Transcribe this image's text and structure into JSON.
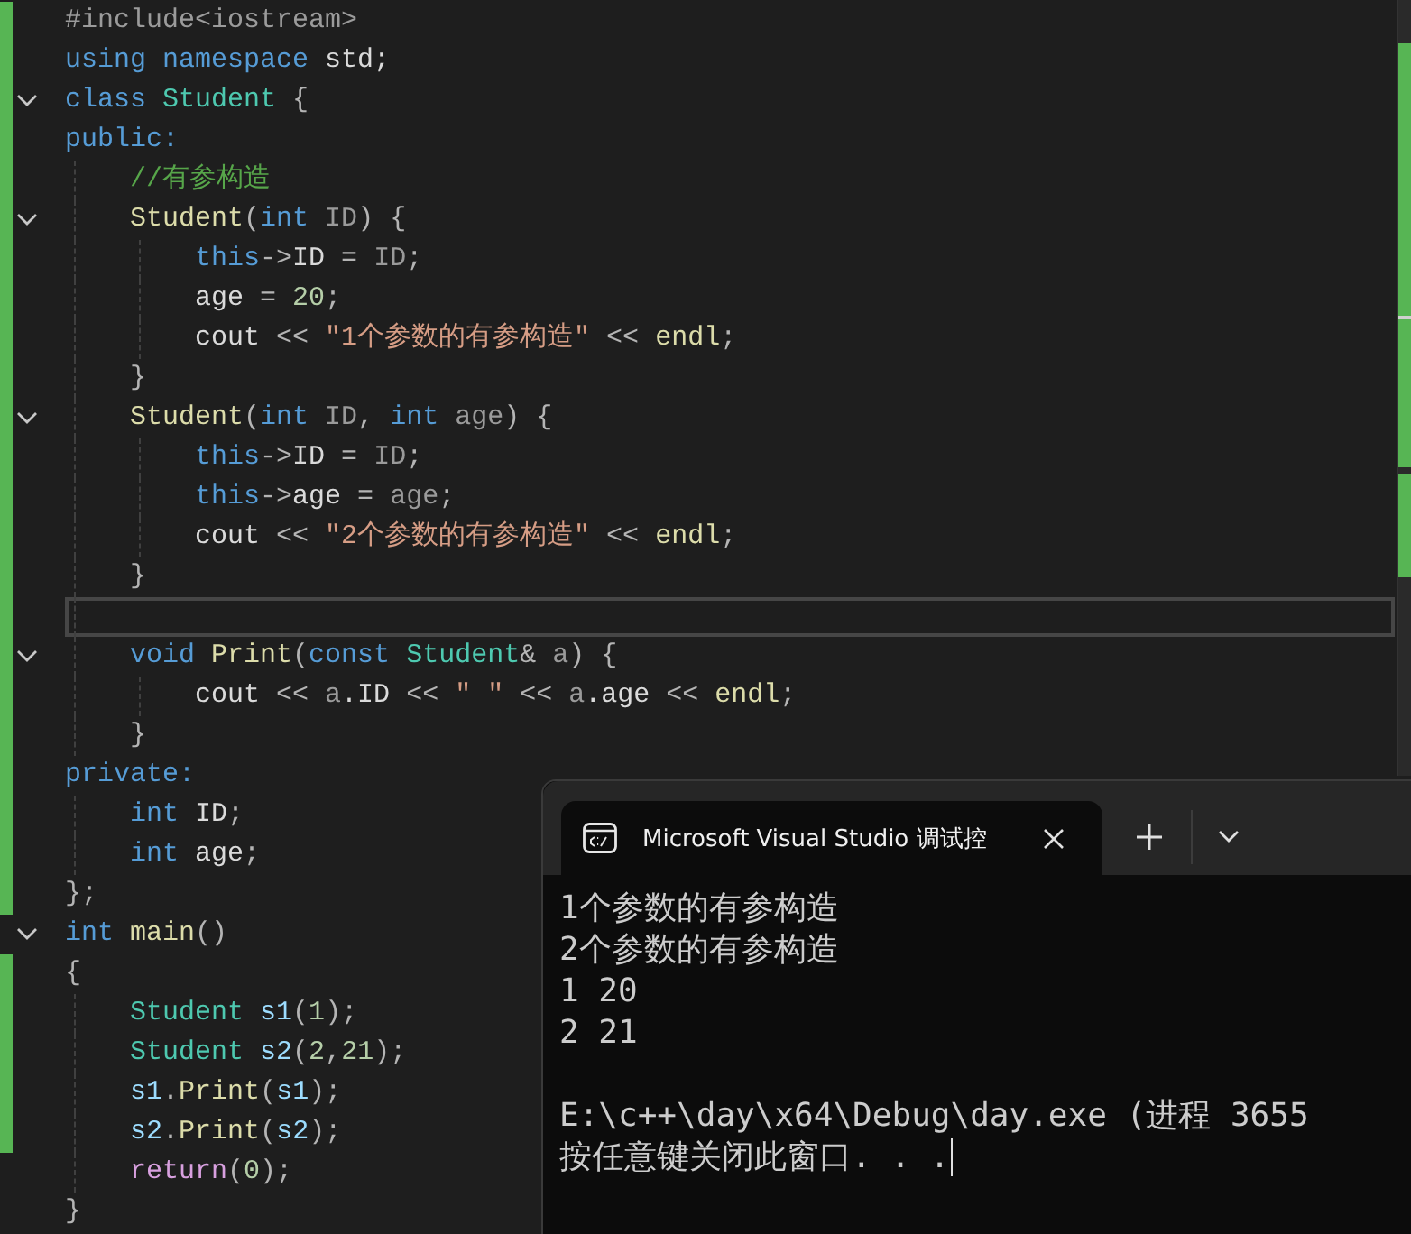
{
  "editor": {
    "lines": [
      {
        "tokens": [
          {
            "text": "#include<iostream>",
            "kind": "pp"
          }
        ],
        "changed": true,
        "current": false
      },
      {
        "tokens": [
          {
            "text": "using",
            "kind": "kw"
          },
          {
            "text": " namespace",
            "kind": "kw"
          },
          {
            "text": " std;",
            "kind": "field"
          }
        ],
        "changed": true,
        "current": false
      },
      {
        "tokens": [
          {
            "text": "class",
            "kind": "kw"
          },
          {
            "text": " Student",
            "kind": "type"
          },
          {
            "text": " {",
            "kind": "p"
          }
        ],
        "changed": true,
        "current": false,
        "collapsed": false
      },
      {
        "tokens": [
          {
            "text": "public:",
            "kind": "kw"
          }
        ],
        "changed": true,
        "current": false,
        "children": [
          {
            "tokens": [
              {
                "text": "//有参构造",
                "kind": "cmt"
              }
            ],
            "changed": true,
            "current": false
          },
          {
            "tokens": [
              {
                "text": "Student",
                "kind": "fn"
              },
              {
                "text": "(",
                "kind": "p"
              },
              {
                "text": "int",
                "kind": "kw"
              },
              {
                "text": " ID",
                "kind": "param"
              },
              {
                "text": ") {",
                "kind": "p"
              }
            ],
            "changed": true,
            "current": false,
            "collapsed": false,
            "children": [
              {
                "tokens": [
                  {
                    "text": "this",
                    "kind": "kw"
                  },
                  {
                    "text": "->",
                    "kind": "p"
                  },
                  {
                    "text": "ID",
                    "kind": "field"
                  },
                  {
                    "text": " = ",
                    "kind": "p"
                  },
                  {
                    "text": "ID",
                    "kind": "param"
                  },
                  {
                    "text": ";",
                    "kind": "p"
                  }
                ],
                "changed": true,
                "current": false
              },
              {
                "tokens": [
                  {
                    "text": "age",
                    "kind": "field"
                  },
                  {
                    "text": " = ",
                    "kind": "p"
                  },
                  {
                    "text": "20",
                    "kind": "num"
                  },
                  {
                    "text": ";",
                    "kind": "p"
                  }
                ],
                "changed": true,
                "current": false
              },
              {
                "tokens": [
                  {
                    "text": "cout",
                    "kind": "field"
                  },
                  {
                    "text": " << ",
                    "kind": "p"
                  },
                  {
                    "text": "\"1个参数的有参构造\"",
                    "kind": "str"
                  },
                  {
                    "text": " << ",
                    "kind": "p"
                  },
                  {
                    "text": "endl",
                    "kind": "fn"
                  },
                  {
                    "text": ";",
                    "kind": "p"
                  }
                ],
                "changed": true,
                "current": false
              }
            ]
          },
          {
            "tokens": [
              {
                "text": "}",
                "kind": "p"
              }
            ],
            "changed": true,
            "current": false
          },
          {
            "tokens": [
              {
                "text": "Student",
                "kind": "fn"
              },
              {
                "text": "(",
                "kind": "p"
              },
              {
                "text": "int",
                "kind": "kw"
              },
              {
                "text": " ID",
                "kind": "param"
              },
              {
                "text": ",",
                "kind": "p"
              },
              {
                "text": " int",
                "kind": "kw"
              },
              {
                "text": " age",
                "kind": "param"
              },
              {
                "text": ") {",
                "kind": "p"
              }
            ],
            "changed": true,
            "current": false,
            "collapsed": false,
            "children": [
              {
                "tokens": [
                  {
                    "text": "this",
                    "kind": "kw"
                  },
                  {
                    "text": "->",
                    "kind": "p"
                  },
                  {
                    "text": "ID",
                    "kind": "field"
                  },
                  {
                    "text": " = ",
                    "kind": "p"
                  },
                  {
                    "text": "ID",
                    "kind": "param"
                  },
                  {
                    "text": ";",
                    "kind": "p"
                  }
                ],
                "changed": true,
                "current": false
              },
              {
                "tokens": [
                  {
                    "text": "this",
                    "kind": "kw"
                  },
                  {
                    "text": "->",
                    "kind": "p"
                  },
                  {
                    "text": "age",
                    "kind": "field"
                  },
                  {
                    "text": " = ",
                    "kind": "p"
                  },
                  {
                    "text": "age",
                    "kind": "param"
                  },
                  {
                    "text": ";",
                    "kind": "p"
                  }
                ],
                "changed": true,
                "current": false
              },
              {
                "tokens": [
                  {
                    "text": "cout",
                    "kind": "field"
                  },
                  {
                    "text": " << ",
                    "kind": "p"
                  },
                  {
                    "text": "\"2个参数的有参构造\"",
                    "kind": "str"
                  },
                  {
                    "text": " << ",
                    "kind": "p"
                  },
                  {
                    "text": "endl",
                    "kind": "fn"
                  },
                  {
                    "text": ";",
                    "kind": "p"
                  }
                ],
                "changed": true,
                "current": false
              }
            ]
          },
          {
            "tokens": [
              {
                "text": "}",
                "kind": "p"
              }
            ],
            "changed": true,
            "current": false
          },
          {
            "changed": true,
            "current": true
          },
          {
            "tokens": [
              {
                "text": "void",
                "kind": "kw"
              },
              {
                "text": " Print",
                "kind": "fn"
              },
              {
                "text": "(",
                "kind": "p"
              },
              {
                "text": "const",
                "kind": "kw"
              },
              {
                "text": " Student",
                "kind": "type"
              },
              {
                "text": "&",
                "kind": "p"
              },
              {
                "text": " a",
                "kind": "param"
              },
              {
                "text": ") {",
                "kind": "p"
              }
            ],
            "changed": true,
            "current": false,
            "collapsed": false,
            "children": [
              {
                "tokens": [
                  {
                    "text": "cout",
                    "kind": "field"
                  },
                  {
                    "text": " << ",
                    "kind": "p"
                  },
                  {
                    "text": "a",
                    "kind": "param"
                  },
                  {
                    "text": ".ID",
                    "kind": "field"
                  },
                  {
                    "text": " << ",
                    "kind": "p"
                  },
                  {
                    "text": "\" \"",
                    "kind": "str"
                  },
                  {
                    "text": " << ",
                    "kind": "p"
                  },
                  {
                    "text": "a",
                    "kind": "param"
                  },
                  {
                    "text": ".age",
                    "kind": "field"
                  },
                  {
                    "text": " << ",
                    "kind": "p"
                  },
                  {
                    "text": "endl",
                    "kind": "fn"
                  },
                  {
                    "text": ";",
                    "kind": "p"
                  }
                ],
                "changed": true,
                "current": false
              }
            ]
          },
          {
            "tokens": [
              {
                "text": "}",
                "kind": "p"
              }
            ],
            "changed": true,
            "current": false
          }
        ]
      },
      {
        "tokens": [
          {
            "text": "private:",
            "kind": "kw"
          }
        ],
        "changed": true,
        "current": false,
        "children": [
          {
            "tokens": [
              {
                "text": "int",
                "kind": "kw"
              },
              {
                "text": " ID",
                "kind": "field"
              },
              {
                "text": ";",
                "kind": "p"
              }
            ],
            "changed": true,
            "current": false
          },
          {
            "tokens": [
              {
                "text": "int",
                "kind": "kw"
              },
              {
                "text": " age",
                "kind": "field"
              },
              {
                "text": ";",
                "kind": "p"
              }
            ],
            "changed": true,
            "current": false
          }
        ]
      },
      {
        "tokens": [
          {
            "text": "};",
            "kind": "p"
          }
        ],
        "changed": true,
        "current": false
      },
      {
        "tokens": [
          {
            "text": "int",
            "kind": "kw"
          },
          {
            "text": " main",
            "kind": "fn"
          },
          {
            "text": "()",
            "kind": "p"
          }
        ],
        "changed": false,
        "current": false,
        "collapsed": false
      },
      {
        "tokens": [
          {
            "text": "{",
            "kind": "p"
          }
        ],
        "changed": true,
        "current": false,
        "children": [
          {
            "tokens": [
              {
                "text": "Student",
                "kind": "type"
              },
              {
                "text": " s1",
                "kind": "var"
              },
              {
                "text": "(",
                "kind": "p"
              },
              {
                "text": "1",
                "kind": "num"
              },
              {
                "text": ");",
                "kind": "p"
              }
            ],
            "changed": true,
            "current": false
          },
          {
            "tokens": [
              {
                "text": "Student",
                "kind": "type"
              },
              {
                "text": " s2",
                "kind": "var"
              },
              {
                "text": "(",
                "kind": "p"
              },
              {
                "text": "2",
                "kind": "num"
              },
              {
                "text": ",",
                "kind": "p"
              },
              {
                "text": "21",
                "kind": "num"
              },
              {
                "text": ");",
                "kind": "p"
              }
            ],
            "changed": true,
            "current": false
          },
          {
            "tokens": [
              {
                "text": "s1",
                "kind": "var"
              },
              {
                "text": ".",
                "kind": "p"
              },
              {
                "text": "Print",
                "kind": "fn"
              },
              {
                "text": "(",
                "kind": "p"
              },
              {
                "text": "s1",
                "kind": "var"
              },
              {
                "text": ");",
                "kind": "p"
              }
            ],
            "changed": true,
            "current": false
          },
          {
            "tokens": [
              {
                "text": "s2",
                "kind": "var"
              },
              {
                "text": ".",
                "kind": "p"
              },
              {
                "text": "Print",
                "kind": "fn"
              },
              {
                "text": "(",
                "kind": "p"
              },
              {
                "text": "s2",
                "kind": "var"
              },
              {
                "text": ");",
                "kind": "p"
              }
            ],
            "changed": true,
            "current": false
          },
          {
            "tokens": [
              {
                "text": "return",
                "kind": "ctrl"
              },
              {
                "text": "(",
                "kind": "p"
              },
              {
                "text": "0",
                "kind": "num"
              },
              {
                "text": ");",
                "kind": "p"
              }
            ],
            "changed": false,
            "current": false
          }
        ]
      },
      {
        "tokens": [
          {
            "text": "}",
            "kind": "p"
          }
        ],
        "changed": false,
        "current": false
      }
    ]
  },
  "console": {
    "tab": {
      "title": "Microsoft Visual Studio 调试控",
      "selected": true
    },
    "output": [
      "1个参数的有参构造",
      "2个参数的有参构造",
      "1 20",
      "2 21"
    ],
    "footer": [
      "E:\\c++\\day\\x64\\Debug\\day.exe (进程 3655",
      "按任意键关闭此窗口. . ."
    ]
  }
}
